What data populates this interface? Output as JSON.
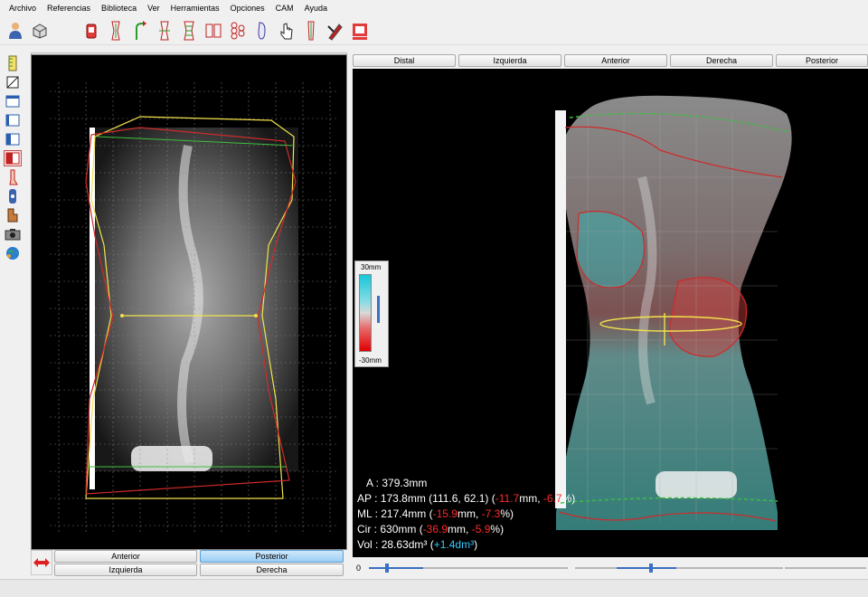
{
  "menu": [
    "Archivo",
    "Referencias",
    "Biblioteca",
    "Ver",
    "Herramientas",
    "Opciones",
    "CAM",
    "Ayuda"
  ],
  "toolbar_icons": [
    "user-icon",
    "box-icon",
    "bucket-icon",
    "torso-icon",
    "rotate-icon",
    "torso-measure-icon",
    "grid-torso-icon",
    "torso-split-icon",
    "spine-icon",
    "foot-icon",
    "hand-cursor-icon",
    "brace-icon",
    "pen-icon",
    "export-icon"
  ],
  "side_icons": [
    "ruler-icon",
    "crop-icon",
    "panel-1-icon",
    "panel-2-icon",
    "panel-3-icon",
    "panel-4-icon",
    "leg-icon",
    "foot-3d-icon",
    "stack-icon",
    "camera-icon",
    "globe-icon"
  ],
  "right_views": [
    "Distal",
    "Izquierda",
    "Anterior",
    "Derecha",
    "Posterior"
  ],
  "left_views": {
    "anterior": "Anterior",
    "posterior": "Posterior",
    "izquierda": "Izquierda",
    "derecha": "Derecha"
  },
  "scale": {
    "top": "30mm",
    "bottom": "-30mm"
  },
  "measures": {
    "a": {
      "label": "A",
      "value": "379.3mm"
    },
    "ap": {
      "label": "AP",
      "value": "173.8mm (111.6, 62.1) (",
      "d1": "-11.7",
      "mid": "mm, ",
      "d2": "-6.7",
      "end": "%)"
    },
    "ml": {
      "label": "ML",
      "value": "217.4mm (",
      "d1": "-15.9",
      "mid": "mm, ",
      "d2": "-7.3",
      "end": "%)"
    },
    "cir": {
      "label": "Cir",
      "value": "630mm (",
      "d1": "-36.9",
      "mid": "mm, ",
      "d2": "-5.9",
      "end": "%)"
    },
    "vol": {
      "label": "Vol",
      "value": "28.63dm³ (",
      "d1": "+1.4dm³",
      "end": ")"
    }
  },
  "slider_value": "0",
  "colors": {
    "accent": "#9ccdf4",
    "negative": "#ff2a2a",
    "positive": "#36c8ff"
  }
}
